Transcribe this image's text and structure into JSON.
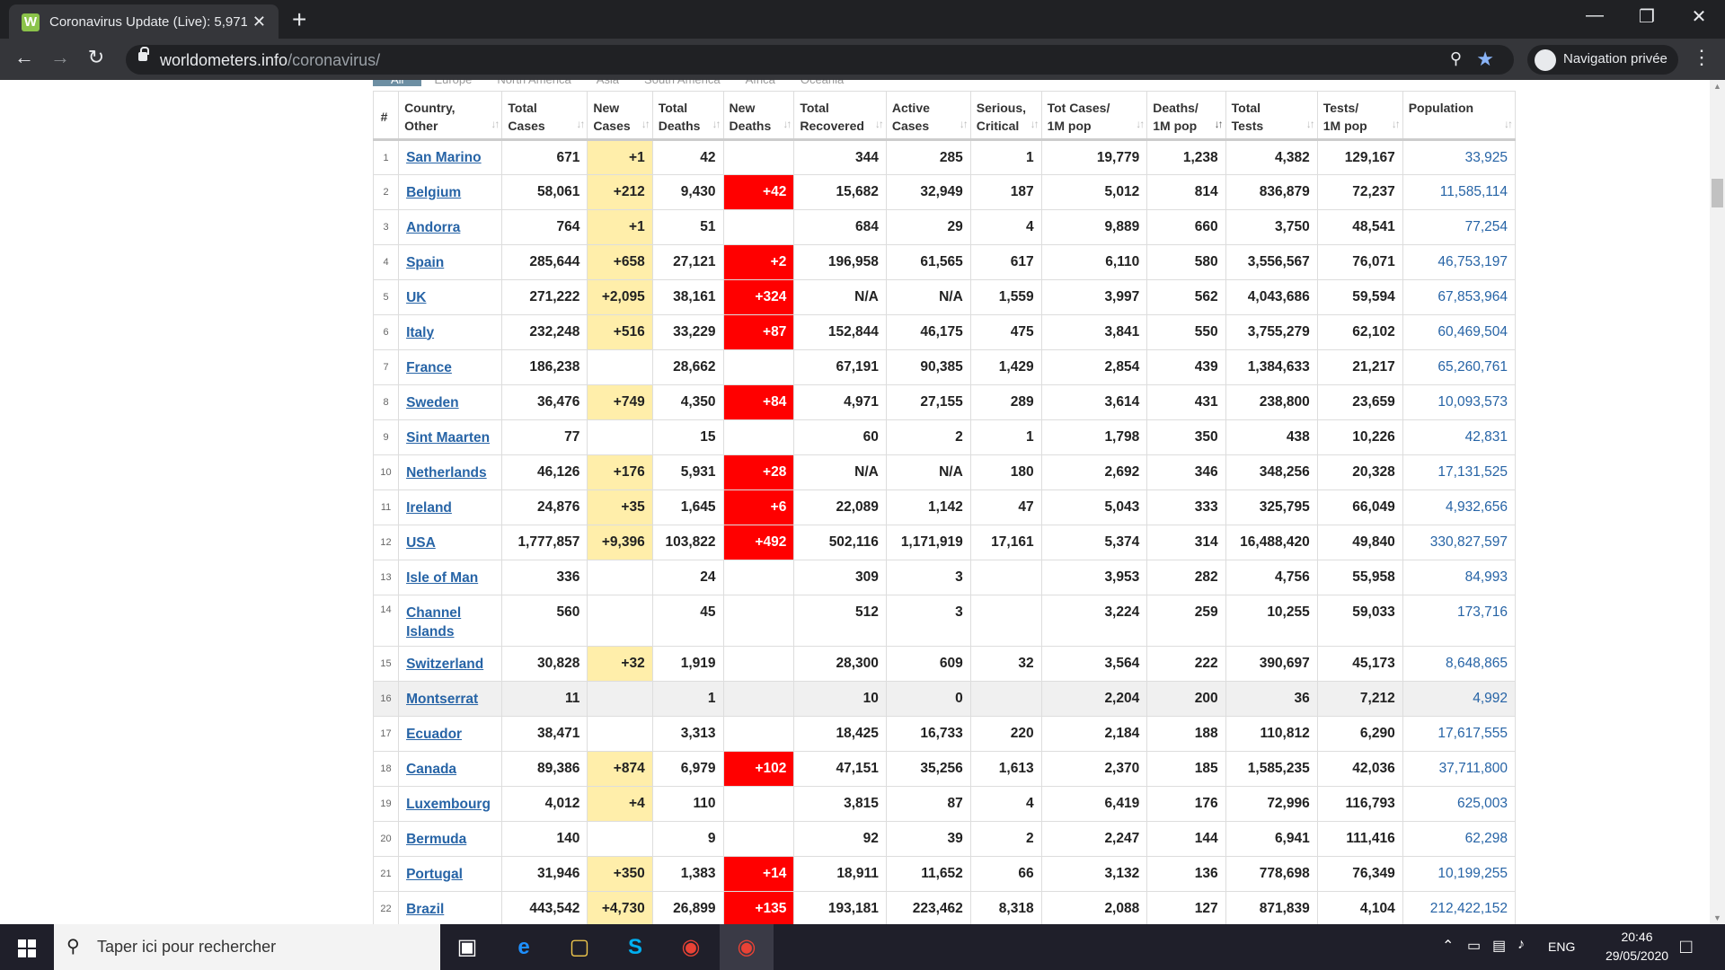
{
  "browser": {
    "tab_title": "Coronavirus Update (Live): 5,971,",
    "url_host": "worldometers.info",
    "url_path": "/coronavirus/",
    "incognito_label": "Navigation privée",
    "new_tab": "+",
    "tab_close": "✕",
    "favicon_letter": "W"
  },
  "region_tabs": [
    "All",
    "Europe",
    "North America",
    "Asia",
    "South America",
    "Africa",
    "Oceania"
  ],
  "table": {
    "headers": {
      "num": "#",
      "country": [
        "Country,",
        "Other"
      ],
      "total_cases": [
        "Total",
        "Cases"
      ],
      "new_cases": [
        "New",
        "Cases"
      ],
      "total_deaths": [
        "Total",
        "Deaths"
      ],
      "new_deaths": [
        "New",
        "Deaths"
      ],
      "total_recovered": [
        "Total",
        "Recovered"
      ],
      "active_cases": [
        "Active",
        "Cases"
      ],
      "serious": [
        "Serious,",
        "Critical"
      ],
      "tot_cases_1m": [
        "Tot Cases/",
        "1M pop"
      ],
      "deaths_1m": [
        "Deaths/",
        "1M pop"
      ],
      "total_tests": [
        "Total",
        "Tests"
      ],
      "tests_1m": [
        "Tests/",
        "1M pop"
      ],
      "population": [
        "Population"
      ]
    },
    "rows": [
      [
        "1",
        "San Marino",
        "671",
        "+1",
        "42",
        "",
        "344",
        "285",
        "1",
        "19,779",
        "1,238",
        "4,382",
        "129,167",
        "33,925"
      ],
      [
        "2",
        "Belgium",
        "58,061",
        "+212",
        "9,430",
        "+42",
        "15,682",
        "32,949",
        "187",
        "5,012",
        "814",
        "836,879",
        "72,237",
        "11,585,114"
      ],
      [
        "3",
        "Andorra",
        "764",
        "+1",
        "51",
        "",
        "684",
        "29",
        "4",
        "9,889",
        "660",
        "3,750",
        "48,541",
        "77,254"
      ],
      [
        "4",
        "Spain",
        "285,644",
        "+658",
        "27,121",
        "+2",
        "196,958",
        "61,565",
        "617",
        "6,110",
        "580",
        "3,556,567",
        "76,071",
        "46,753,197"
      ],
      [
        "5",
        "UK",
        "271,222",
        "+2,095",
        "38,161",
        "+324",
        "N/A",
        "N/A",
        "1,559",
        "3,997",
        "562",
        "4,043,686",
        "59,594",
        "67,853,964"
      ],
      [
        "6",
        "Italy",
        "232,248",
        "+516",
        "33,229",
        "+87",
        "152,844",
        "46,175",
        "475",
        "3,841",
        "550",
        "3,755,279",
        "62,102",
        "60,469,504"
      ],
      [
        "7",
        "France",
        "186,238",
        "",
        "28,662",
        "",
        "67,191",
        "90,385",
        "1,429",
        "2,854",
        "439",
        "1,384,633",
        "21,217",
        "65,260,761"
      ],
      [
        "8",
        "Sweden",
        "36,476",
        "+749",
        "4,350",
        "+84",
        "4,971",
        "27,155",
        "289",
        "3,614",
        "431",
        "238,800",
        "23,659",
        "10,093,573"
      ],
      [
        "9",
        "Sint Maarten",
        "77",
        "",
        "15",
        "",
        "60",
        "2",
        "1",
        "1,798",
        "350",
        "438",
        "10,226",
        "42,831"
      ],
      [
        "10",
        "Netherlands",
        "46,126",
        "+176",
        "5,931",
        "+28",
        "N/A",
        "N/A",
        "180",
        "2,692",
        "346",
        "348,256",
        "20,328",
        "17,131,525"
      ],
      [
        "11",
        "Ireland",
        "24,876",
        "+35",
        "1,645",
        "+6",
        "22,089",
        "1,142",
        "47",
        "5,043",
        "333",
        "325,795",
        "66,049",
        "4,932,656"
      ],
      [
        "12",
        "USA",
        "1,777,857",
        "+9,396",
        "103,822",
        "+492",
        "502,116",
        "1,171,919",
        "17,161",
        "5,374",
        "314",
        "16,488,420",
        "49,840",
        "330,827,597"
      ],
      [
        "13",
        "Isle of Man",
        "336",
        "",
        "24",
        "",
        "309",
        "3",
        "",
        "3,953",
        "282",
        "4,756",
        "55,958",
        "84,993"
      ],
      [
        "14",
        "Channel Islands",
        "560",
        "",
        "45",
        "",
        "512",
        "3",
        "",
        "3,224",
        "259",
        "10,255",
        "59,033",
        "173,716"
      ],
      [
        "15",
        "Switzerland",
        "30,828",
        "+32",
        "1,919",
        "",
        "28,300",
        "609",
        "32",
        "3,564",
        "222",
        "390,697",
        "45,173",
        "8,648,865"
      ],
      [
        "16",
        "Montserrat",
        "11",
        "",
        "1",
        "",
        "10",
        "0",
        "",
        "2,204",
        "200",
        "36",
        "7,212",
        "4,992"
      ],
      [
        "17",
        "Ecuador",
        "38,471",
        "",
        "3,313",
        "",
        "18,425",
        "16,733",
        "220",
        "2,184",
        "188",
        "110,812",
        "6,290",
        "17,617,555"
      ],
      [
        "18",
        "Canada",
        "89,386",
        "+874",
        "6,979",
        "+102",
        "47,151",
        "35,256",
        "1,613",
        "2,370",
        "185",
        "1,585,235",
        "42,036",
        "37,711,800"
      ],
      [
        "19",
        "Luxembourg",
        "4,012",
        "+4",
        "110",
        "",
        "3,815",
        "87",
        "4",
        "6,419",
        "176",
        "72,996",
        "116,793",
        "625,003"
      ],
      [
        "20",
        "Bermuda",
        "140",
        "",
        "9",
        "",
        "92",
        "39",
        "2",
        "2,247",
        "144",
        "6,941",
        "111,416",
        "62,298"
      ],
      [
        "21",
        "Portugal",
        "31,946",
        "+350",
        "1,383",
        "+14",
        "18,911",
        "11,652",
        "66",
        "3,132",
        "136",
        "778,698",
        "76,349",
        "10,199,255"
      ],
      [
        "22",
        "Brazil",
        "443,542",
        "+4,730",
        "26,899",
        "+135",
        "193,181",
        "223,462",
        "8,318",
        "2,088",
        "127",
        "871,839",
        "4,104",
        "212,422,152"
      ]
    ]
  },
  "taskbar": {
    "search_placeholder": "Taper ici pour rechercher",
    "language": "ENG",
    "time": "20:46",
    "date": "29/05/2020"
  },
  "colors": {
    "new_cases_bg": "#ffeeaa",
    "new_deaths_bg": "#ff0000",
    "link": "#2764a6"
  }
}
